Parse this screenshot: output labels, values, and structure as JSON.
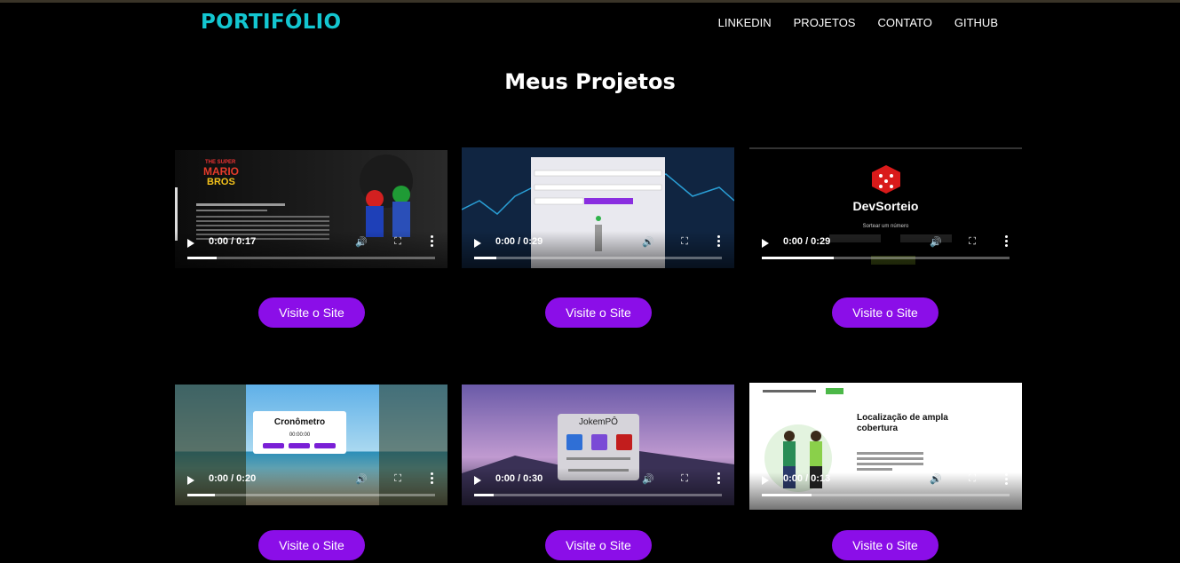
{
  "header": {
    "logo": "PORTIFÓLIO",
    "nav": [
      "LINKEDIN",
      "PROJETOS",
      "CONTATO",
      "GITHUB"
    ]
  },
  "page_title": "Meus Projetos",
  "projects": [
    {
      "time": "0:00 / 0:17",
      "progress": 0.12,
      "button": "Visite o Site",
      "thumb": "mario"
    },
    {
      "time": "0:00 / 0:29",
      "progress": 0.09,
      "button": "Visite o Site",
      "thumb": "market"
    },
    {
      "time": "0:00 / 0:29",
      "progress": 0.29,
      "button": "Visite o Site",
      "thumb": "dice",
      "overlay_title": "DevSorteio",
      "overlay_sub": "Sortear um número"
    },
    {
      "time": "0:00 / 0:20",
      "progress": 0.11,
      "button": "Visite o Site",
      "thumb": "beach",
      "overlay_title": "Cronômetro",
      "overlay_sub": "00:00:00"
    },
    {
      "time": "0:00 / 0:30",
      "progress": 0.08,
      "button": "Visite o Site",
      "thumb": "mountain",
      "overlay_title": "JokemPÔ"
    },
    {
      "time": "0:00 / 0:13",
      "progress": 0.2,
      "button": "Visite o Site",
      "thumb": "coverage",
      "overlay_title": "Localização de ampla cobertura"
    }
  ],
  "colors": {
    "accent": "#8b0ee8",
    "logo": "#13c6d0"
  }
}
